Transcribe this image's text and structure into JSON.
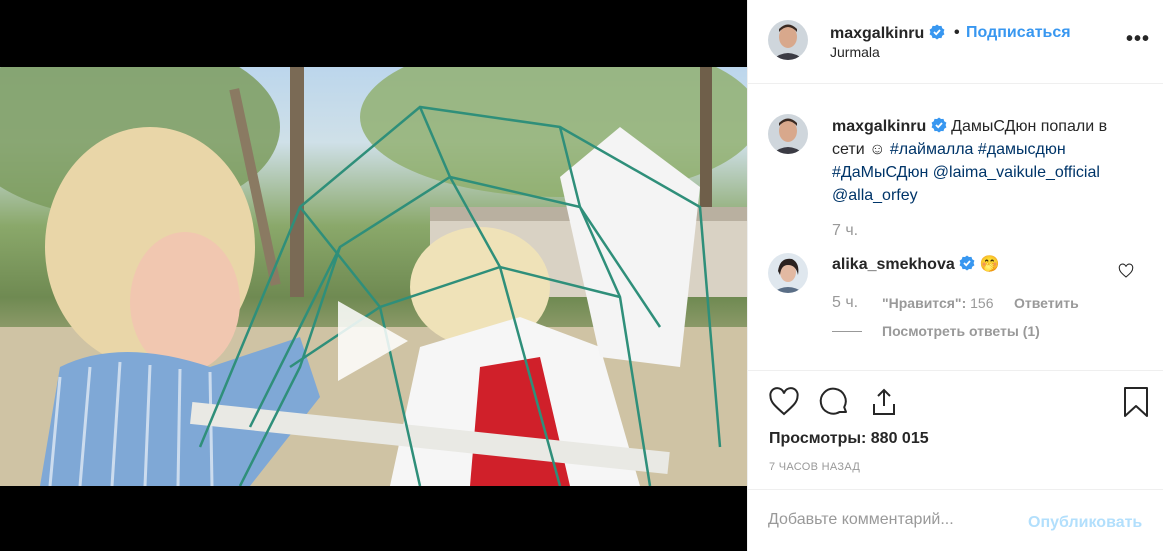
{
  "post": {
    "author": "maxgalkinru",
    "dot": "•",
    "follow_label": "Подписаться",
    "location": "Jurmala",
    "more_icon": "more-horizontal-icon",
    "more_glyph": "•••"
  },
  "caption": {
    "username": "maxgalkinru",
    "text_1": "ДамыСДюн попали в сети",
    "emoji": "☺",
    "hashtags": [
      "#лаймалла",
      "#дамысдюн",
      "#ДаМыСДюн"
    ],
    "mentions": [
      "@laima_vaikule_official",
      "@alla_orfey"
    ],
    "time": "7 ч."
  },
  "comment": {
    "username": "alika_smekhova",
    "text": "🤭",
    "time": "5 ч.",
    "likes_label": "\"Нравится\":",
    "likes_count": "156",
    "reply_label": "Ответить",
    "view_replies": "Посмотреть ответы (1)"
  },
  "actions": {
    "icons": [
      "heart-icon",
      "comment-icon",
      "share-icon",
      "bookmark-icon"
    ],
    "views": "Просмотры: 880 015",
    "time_ago": "7 ЧАСОВ НАЗАД"
  },
  "add_comment": {
    "placeholder": "Добавьте комментарий...",
    "publish_label": "Опубликовать"
  },
  "colors": {
    "link": "#003569",
    "follow": "#3897f0",
    "publish_disabled": "#b2dffc",
    "muted": "#999999",
    "border": "#efefef"
  }
}
